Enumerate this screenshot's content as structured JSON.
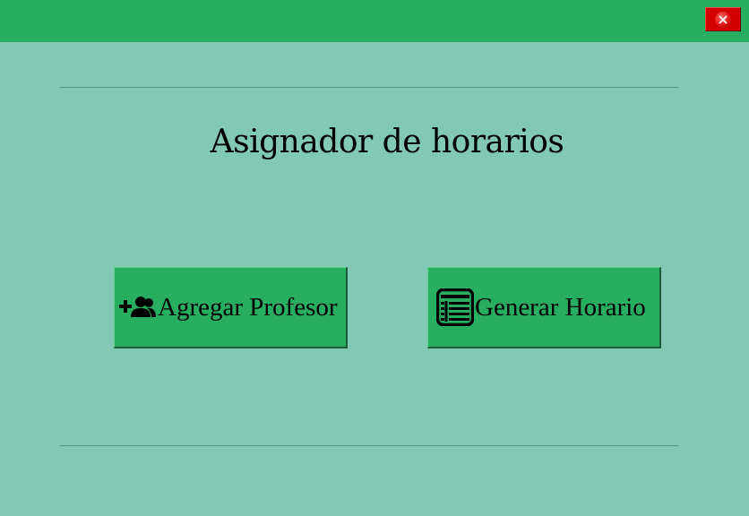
{
  "window": {
    "title": "",
    "close_icon": "close-icon",
    "colors": {
      "titlebar": "#27ae60",
      "background": "#81c9b4",
      "close_button": "#d40000"
    }
  },
  "main": {
    "title": "Asignador de horarios",
    "buttons": [
      {
        "label": "Agregar Profesor",
        "icon": "add-user-group-icon",
        "color": "#27ae60"
      },
      {
        "label": "Generar Horario",
        "icon": "table-list-icon",
        "color": "#27ae60"
      }
    ]
  }
}
